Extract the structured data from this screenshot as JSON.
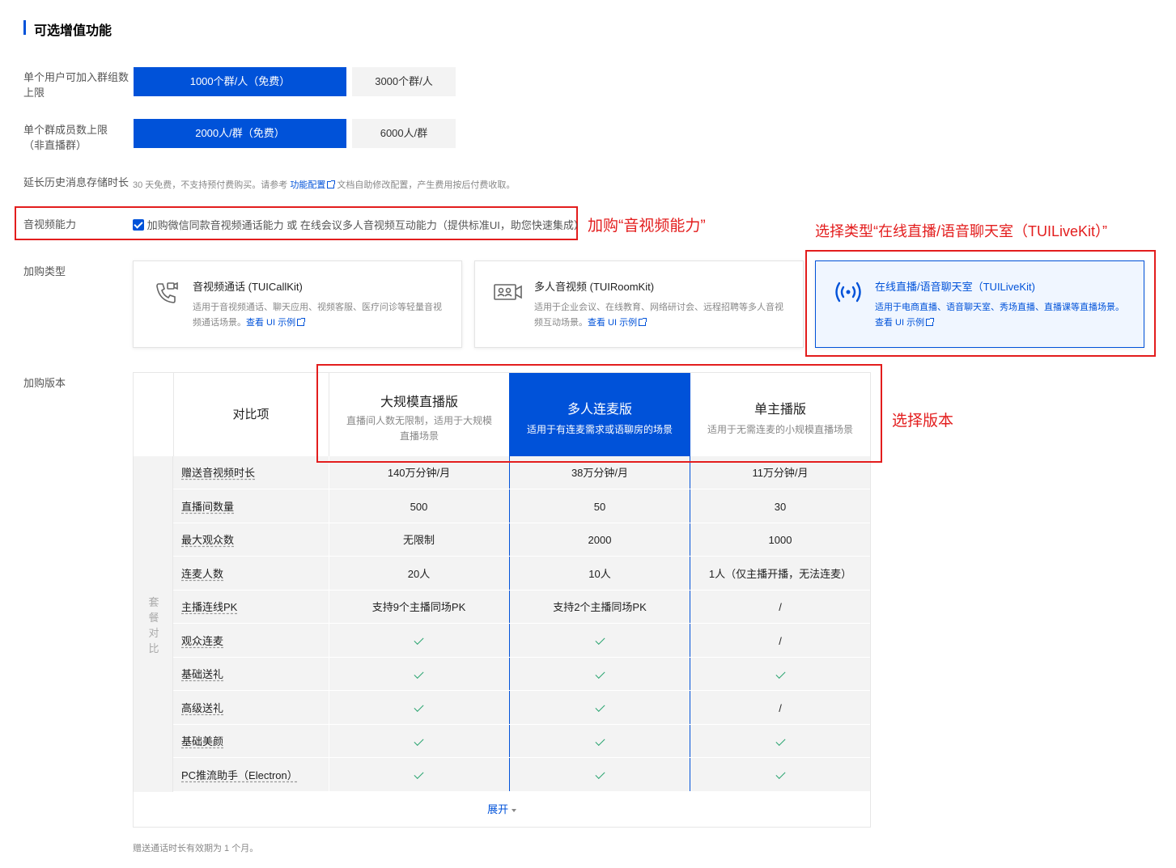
{
  "section_title": "可选增值功能",
  "group_limit": {
    "label": "单个用户可加入群组数上限",
    "options": [
      "1000个群/人（免费）",
      "3000个群/人"
    ]
  },
  "member_limit": {
    "label_line1": "单个群成员数上限",
    "label_line2": "（非直播群）",
    "options": [
      "2000人/群（免费）",
      "6000人/群"
    ]
  },
  "history": {
    "label": "延长历史消息存储时长",
    "hint_before": "30 天免费，不支持预付费购买。请参考",
    "link": "功能配置",
    "hint_after": "文档自助修改配置，产生费用按后付费收取。"
  },
  "av": {
    "label": "音视频能力",
    "checkbox_text": "加购微信同款音视频通话能力 或 在线会议多人音视频互动能力（提供标准UI，助您快速集成）",
    "annotation": "加购“音视频能力”"
  },
  "purchase_type": {
    "label": "加购类型",
    "annotation": "选择类型“在线直播/语音聊天室（TUILiveKit）”",
    "cards": [
      {
        "title": "音视频通话 (TUICallKit)",
        "desc1": "适用于音视频通话、聊天应用、视频客服、医疗问诊等轻量音视",
        "desc2": "频通话场景。",
        "link": "查看 UI 示例",
        "icon": "phone-video-icon"
      },
      {
        "title": "多人音视频 (TUIRoomKit)",
        "desc1": "适用于企业会议、在线教育、网络研讨会、远程招聘等多人音视",
        "desc2": "频互动场景。",
        "link": "查看 UI 示例",
        "icon": "meeting-room-icon"
      },
      {
        "title": "在线直播/语音聊天室（TUILiveKit)",
        "desc1": "适用于电商直播、语音聊天室、秀场直播、直播课等直播场景。",
        "desc2": "",
        "link": "查看 UI 示例",
        "icon": "broadcast-icon"
      }
    ]
  },
  "purchase_version": {
    "label": "加购版本",
    "annotation": "选择版本",
    "compare_header": "对比项",
    "side_label": [
      "套",
      "餐",
      "对",
      "比"
    ],
    "plans": [
      {
        "title": "大规模直播版",
        "sub1": "直播间人数无限制，适用于大规模",
        "sub2": "直播场景"
      },
      {
        "title": "多人连麦版",
        "sub1": "适用于有连麦需求或语聊房的场景",
        "sub2": ""
      },
      {
        "title": "单主播版",
        "sub1": "适用于无需连麦的小规模直播场景",
        "sub2": ""
      }
    ],
    "rows": [
      {
        "label": "赠送音视频时长",
        "v": [
          "140万分钟/月",
          "38万分钟/月",
          "11万分钟/月"
        ]
      },
      {
        "label": "直播间数量",
        "v": [
          "500",
          "50",
          "30"
        ]
      },
      {
        "label": "最大观众数",
        "v": [
          "无限制",
          "2000",
          "1000"
        ]
      },
      {
        "label": "连麦人数",
        "v": [
          "20人",
          "10人",
          "1人（仅主播开播，无法连麦）"
        ]
      },
      {
        "label": "主播连线PK",
        "v": [
          "支持9个主播同场PK",
          "支持2个主播同场PK",
          "/"
        ]
      },
      {
        "label": "观众连麦",
        "v": [
          "check",
          "check",
          "/"
        ]
      },
      {
        "label": "基础送礼",
        "v": [
          "check",
          "check",
          "check"
        ]
      },
      {
        "label": "高级送礼",
        "v": [
          "check",
          "check",
          "/"
        ]
      },
      {
        "label": "基础美颜",
        "v": [
          "check",
          "check",
          "check"
        ]
      },
      {
        "label": "PC推流助手（Electron）",
        "v": [
          "check",
          "check",
          "check"
        ]
      }
    ],
    "expand_label": "展开",
    "footnote": "赠送通话时长有效期为 1 个月。"
  }
}
